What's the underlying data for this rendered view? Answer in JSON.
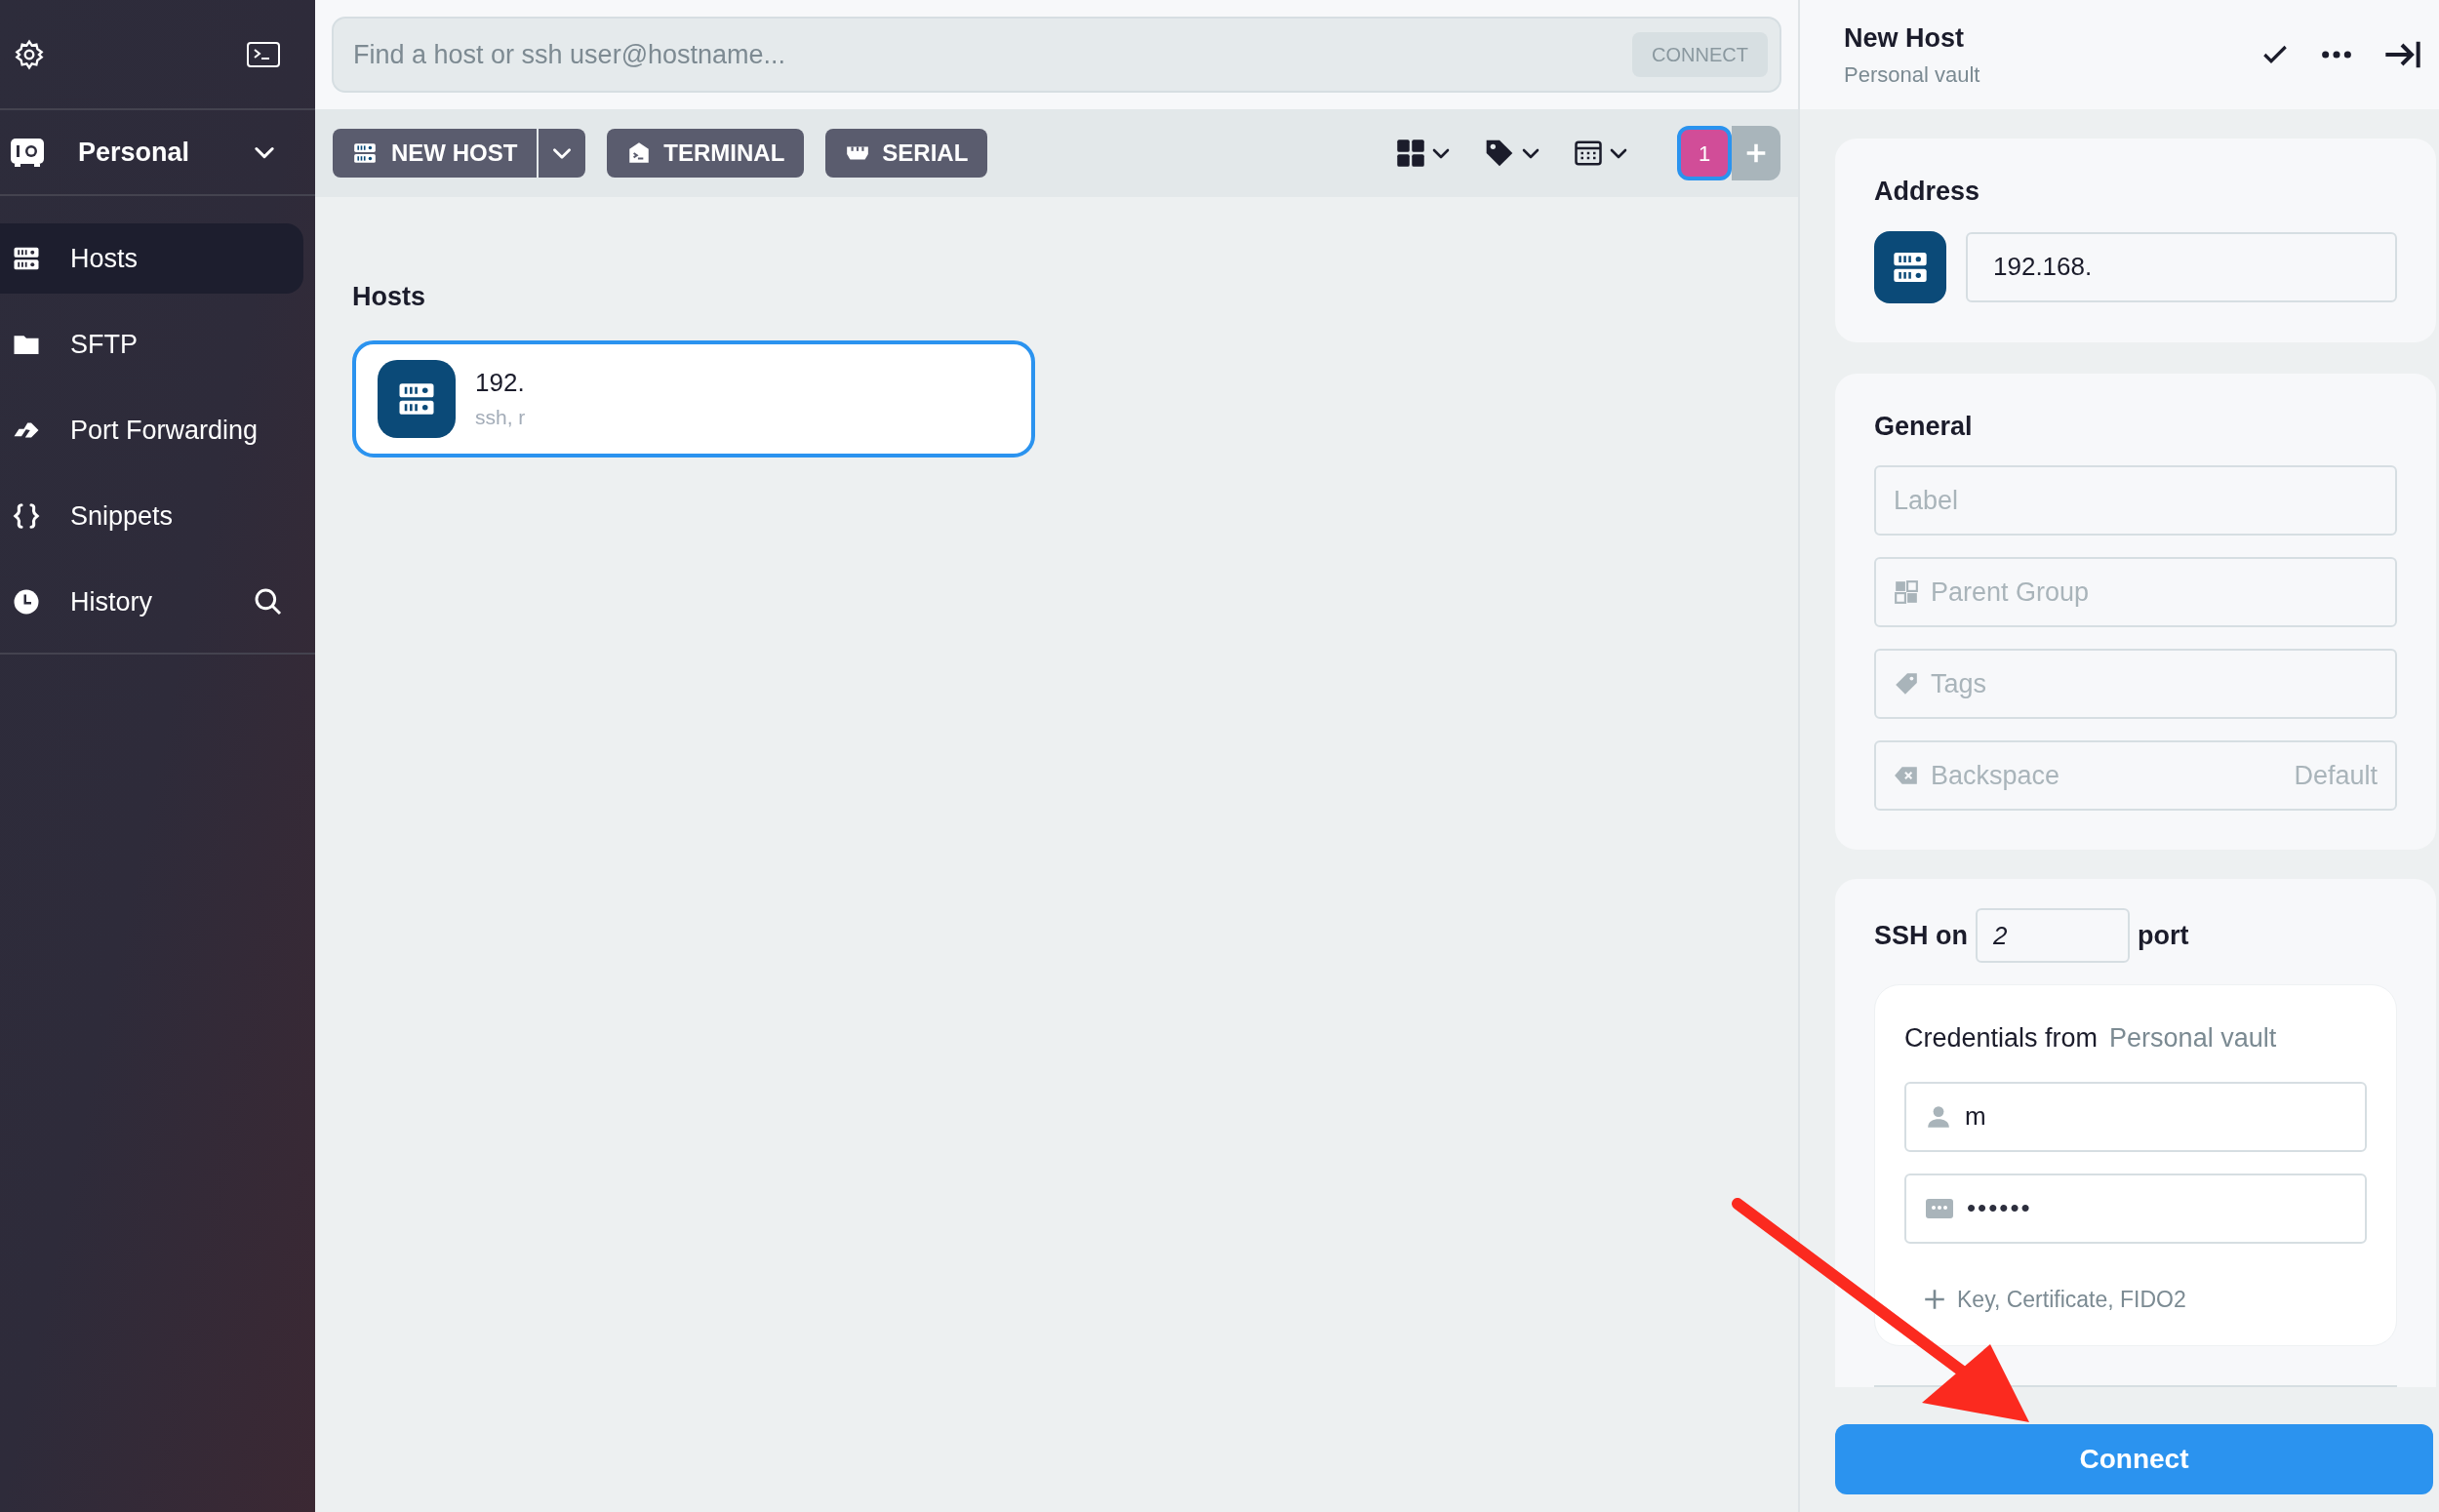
{
  "sidebar": {
    "vault": {
      "label": "Personal"
    },
    "items": [
      {
        "label": "Hosts",
        "selected": true
      },
      {
        "label": "SFTP",
        "selected": false
      },
      {
        "label": "Port Forwarding",
        "selected": false
      },
      {
        "label": "Snippets",
        "selected": false
      },
      {
        "label": "History",
        "selected": false
      }
    ]
  },
  "search": {
    "placeholder": "Find a host or ssh user@hostname...",
    "button": "CONNECT"
  },
  "toolbar": {
    "buttons": [
      {
        "label": "NEW HOST",
        "kind": "split"
      },
      {
        "label": "TERMINAL",
        "kind": "plain"
      },
      {
        "label": "SERIAL",
        "kind": "plain"
      }
    ],
    "badge": "1"
  },
  "hosts": {
    "heading": "Hosts",
    "items": [
      {
        "title": "192.",
        "subtitle": "ssh, r",
        "selected": true
      }
    ]
  },
  "panel": {
    "title": "New Host",
    "subtitle": "Personal vault",
    "address": {
      "heading": "Address",
      "value": "192.168."
    },
    "general": {
      "heading": "General",
      "fields": [
        {
          "placeholder": "Label"
        },
        {
          "placeholder": "Parent Group"
        },
        {
          "placeholder": "Tags"
        },
        {
          "placeholder": "Backspace",
          "hint": "Default"
        }
      ]
    },
    "ssh": {
      "prefix": "SSH on",
      "port": "2",
      "suffix": "port"
    },
    "credentials": {
      "label": "Credentials from",
      "source": "Personal vault",
      "username": "m",
      "password": "••••••",
      "add": "Key, Certificate, FIDO2"
    },
    "connect": "Connect"
  }
}
